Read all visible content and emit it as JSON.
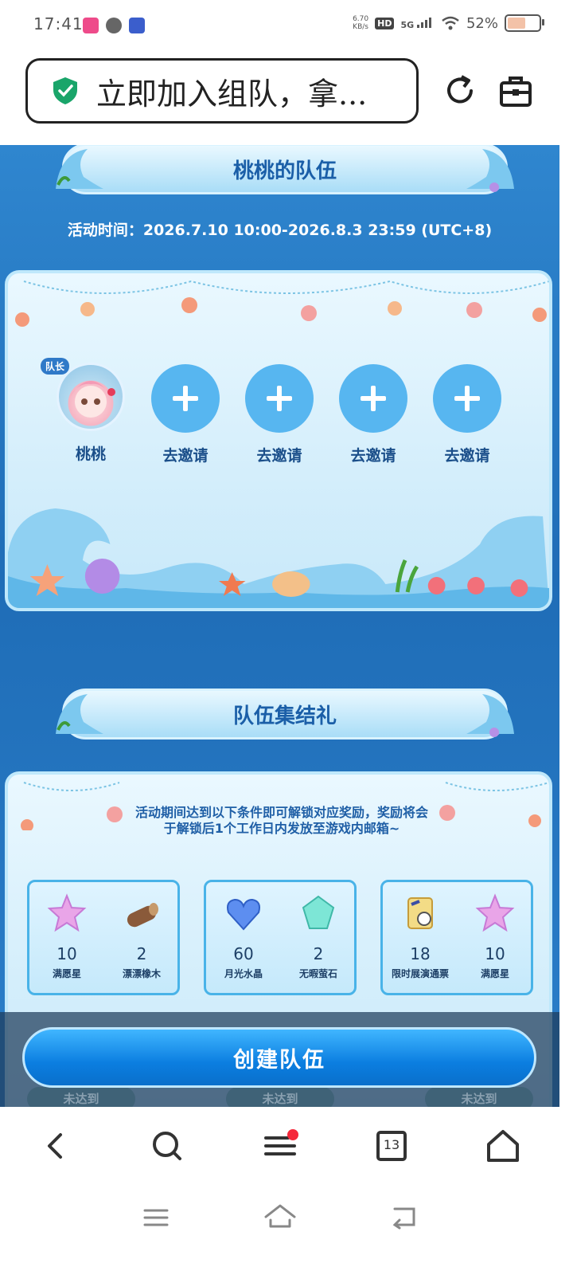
{
  "status_bar": {
    "time": "17:41",
    "net_speed_value": "6.70",
    "net_speed_unit": "KB/s",
    "hd": "HD",
    "signal": "5G",
    "battery": "52%"
  },
  "url_bar": {
    "page_title": "立即加入组队，拿..."
  },
  "team_banner": {
    "title": "桃桃的队伍"
  },
  "event_time": "活动时间：2026.7.10 10:00-2026.8.3 23:59 (UTC+8)",
  "team": {
    "leader_badge": "队长",
    "leader_name": "桃桃",
    "invite_slots": [
      {
        "label": "去邀请"
      },
      {
        "label": "去邀请"
      },
      {
        "label": "去邀请"
      },
      {
        "label": "去邀请"
      }
    ]
  },
  "gift_banner": {
    "title": "队伍集结礼"
  },
  "gift_description": {
    "line1": "活动期间达到以下条件即可解锁对应奖励，奖励将会",
    "line2": "于解锁后1个工作日内发放至游戏内邮箱~"
  },
  "reward_cards": [
    {
      "items": [
        {
          "num": "10",
          "name": "满愿星",
          "icon": "star-icon"
        },
        {
          "num": "2",
          "name": "漂漂橡木",
          "icon": "wood-icon"
        }
      ]
    },
    {
      "items": [
        {
          "num": "60",
          "name": "月光水晶",
          "icon": "heart-crystal-icon"
        },
        {
          "num": "2",
          "name": "无暇萤石",
          "icon": "gem-icon"
        }
      ]
    },
    {
      "items": [
        {
          "num": "18",
          "name": "限时展演通票",
          "icon": "ticket-icon"
        },
        {
          "num": "10",
          "name": "满愿星",
          "icon": "star-icon"
        }
      ]
    }
  ],
  "status_buttons": [
    "未达到",
    "未达到",
    "未达到"
  ],
  "create_team_button": "创建队伍",
  "browser_nav": {
    "tab_count": "13"
  },
  "colors": {
    "sea_blue": "#2f86cf",
    "invite_circle": "#57b6f0",
    "cta_blue": "#0b7ee0",
    "notification_dot": "#f5283a"
  }
}
